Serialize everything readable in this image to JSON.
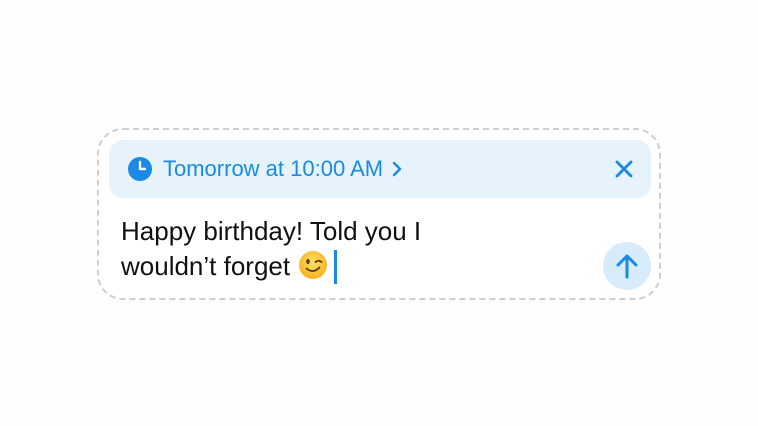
{
  "composer": {
    "schedule": {
      "label": "Tomorrow at 10:00 AM",
      "icon": "clock-icon",
      "chevron_icon": "chevron-right-icon",
      "close_icon": "close-icon"
    },
    "message": {
      "line1": "Happy birthday! Told you I",
      "line2": "wouldn’t forget",
      "emoji": "winking-face-emoji"
    },
    "send_icon": "arrow-up-icon"
  },
  "colors": {
    "accent": "#1a8ae5",
    "schedule_bg": "#e6f2fc",
    "send_bg": "#d7ebfb",
    "text": "#111111",
    "border": "#cfcfcf"
  }
}
